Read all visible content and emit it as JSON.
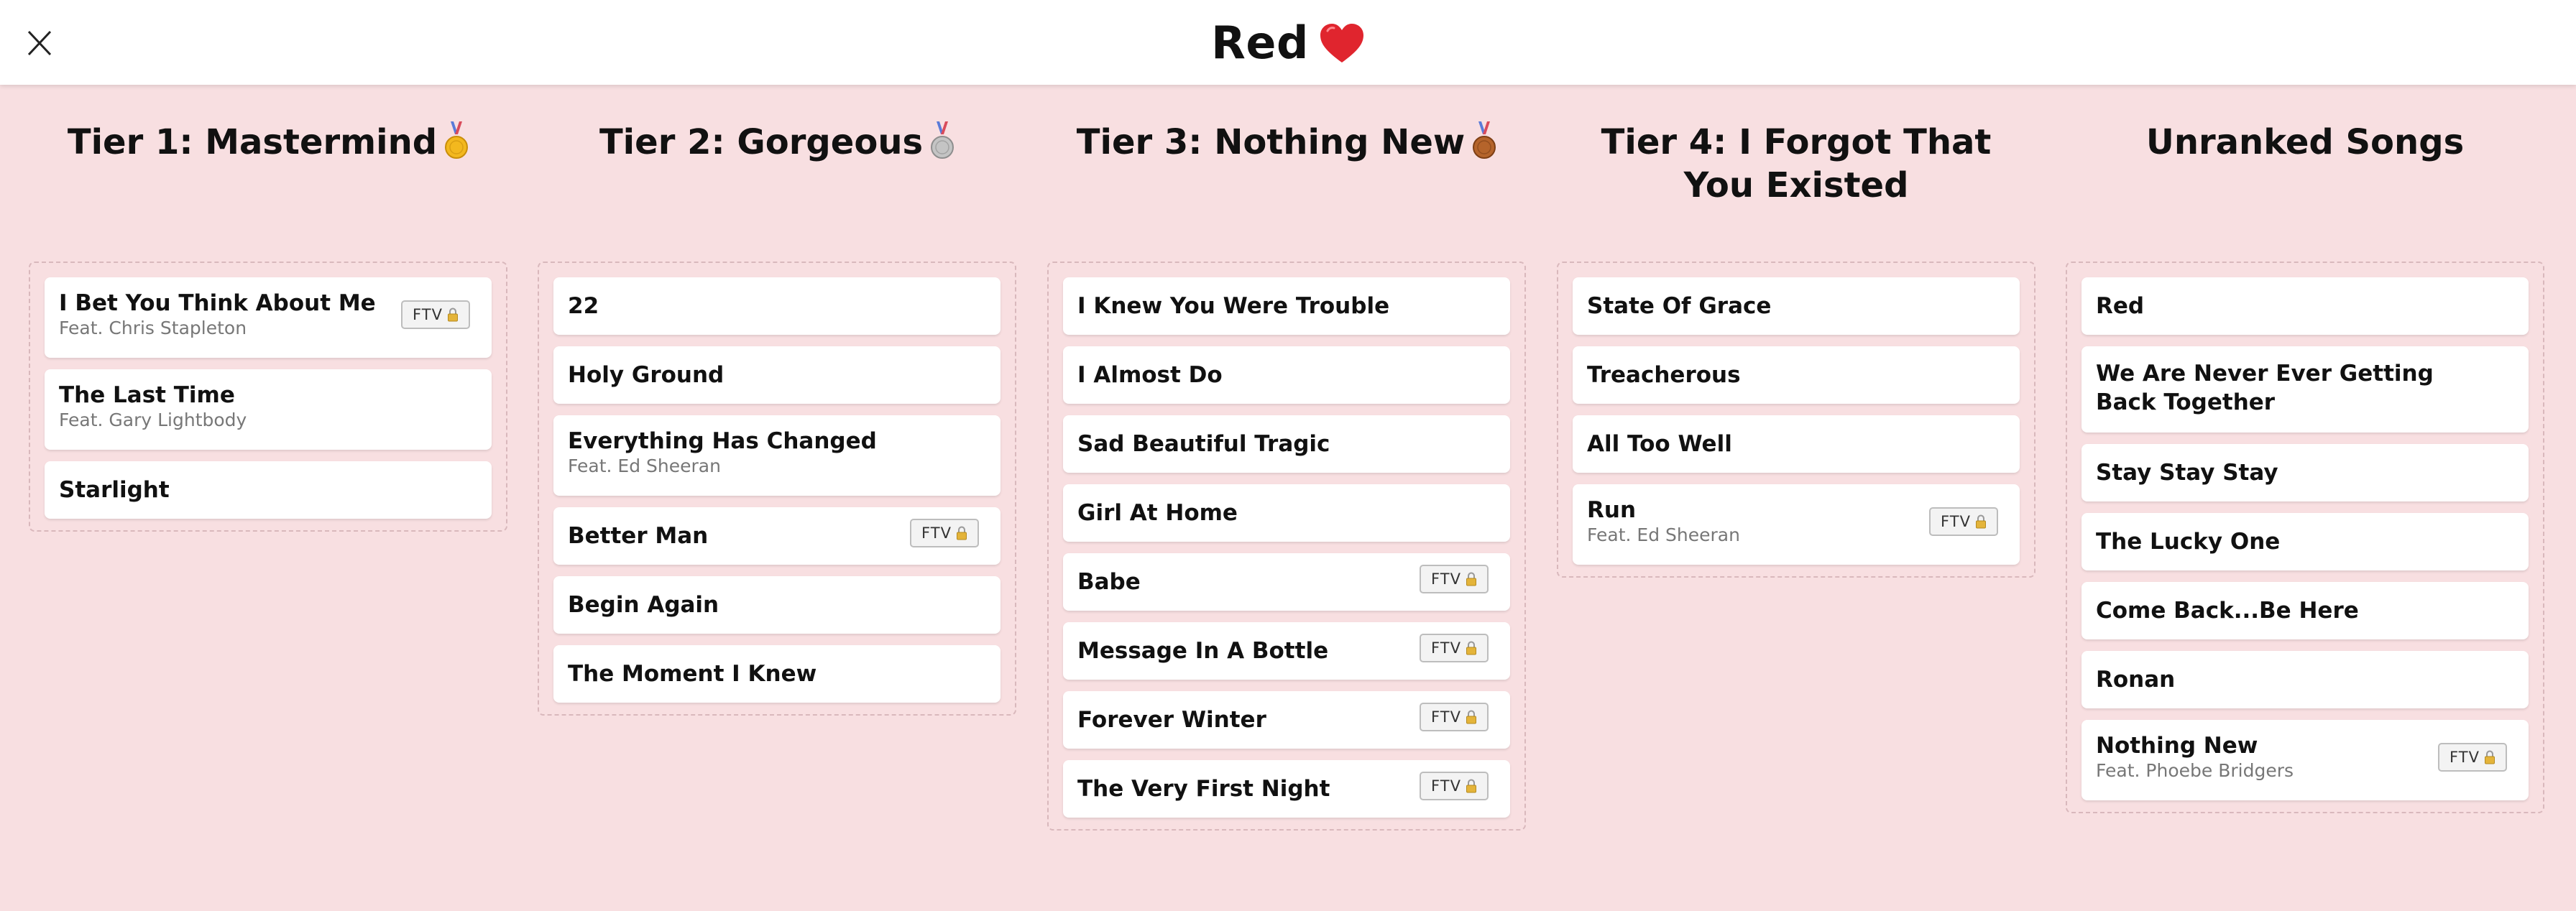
{
  "header": {
    "title": "Red",
    "title_icon": "heart-icon",
    "close_icon": "close-icon"
  },
  "badge_label": "FTV",
  "colors": {
    "background": "#f8dfe1",
    "heart": "#e0252e",
    "gold": "#f3b81e",
    "silver": "#b7b7b7",
    "bronze": "#b5642b"
  },
  "columns": [
    {
      "title": "Tier 1: Mastermind",
      "medal": "gold-medal-icon",
      "songs": [
        {
          "title": "I Bet You Think About Me",
          "feat": "Feat. Chris Stapleton",
          "ftv": true
        },
        {
          "title": "The Last Time",
          "feat": "Feat. Gary Lightbody",
          "ftv": false
        },
        {
          "title": "Starlight",
          "feat": "",
          "ftv": false
        }
      ]
    },
    {
      "title": "Tier 2: Gorgeous",
      "medal": "silver-medal-icon",
      "songs": [
        {
          "title": "22",
          "feat": "",
          "ftv": false
        },
        {
          "title": "Holy Ground",
          "feat": "",
          "ftv": false
        },
        {
          "title": "Everything Has Changed",
          "feat": "Feat. Ed Sheeran",
          "ftv": false
        },
        {
          "title": "Better Man",
          "feat": "",
          "ftv": true
        },
        {
          "title": "Begin Again",
          "feat": "",
          "ftv": false
        },
        {
          "title": "The Moment I Knew",
          "feat": "",
          "ftv": false
        }
      ]
    },
    {
      "title": "Tier 3: Nothing New",
      "medal": "bronze-medal-icon",
      "songs": [
        {
          "title": "I Knew You Were Trouble",
          "feat": "",
          "ftv": false
        },
        {
          "title": "I Almost Do",
          "feat": "",
          "ftv": false
        },
        {
          "title": "Sad Beautiful Tragic",
          "feat": "",
          "ftv": false
        },
        {
          "title": "Girl At Home",
          "feat": "",
          "ftv": false
        },
        {
          "title": "Babe",
          "feat": "",
          "ftv": true
        },
        {
          "title": "Message In A Bottle",
          "feat": "",
          "ftv": true
        },
        {
          "title": "Forever Winter",
          "feat": "",
          "ftv": true
        },
        {
          "title": "The Very First Night",
          "feat": "",
          "ftv": true
        }
      ]
    },
    {
      "title": "Tier 4: I Forgot That You Existed",
      "medal": "",
      "songs": [
        {
          "title": "State Of Grace",
          "feat": "",
          "ftv": false
        },
        {
          "title": "Treacherous",
          "feat": "",
          "ftv": false
        },
        {
          "title": "All Too Well",
          "feat": "",
          "ftv": false
        },
        {
          "title": "Run",
          "feat": "Feat. Ed Sheeran",
          "ftv": true
        }
      ]
    },
    {
      "title": "Unranked Songs",
      "medal": "",
      "songs": [
        {
          "title": "Red",
          "feat": "",
          "ftv": false
        },
        {
          "title": "We Are Never Ever Getting Back Together",
          "feat": "",
          "ftv": false
        },
        {
          "title": "Stay Stay Stay",
          "feat": "",
          "ftv": false
        },
        {
          "title": "The Lucky One",
          "feat": "",
          "ftv": false
        },
        {
          "title": "Come Back...Be Here",
          "feat": "",
          "ftv": false
        },
        {
          "title": "Ronan",
          "feat": "",
          "ftv": false
        },
        {
          "title": "Nothing New",
          "feat": "Feat. Phoebe Bridgers",
          "ftv": true
        }
      ]
    }
  ]
}
